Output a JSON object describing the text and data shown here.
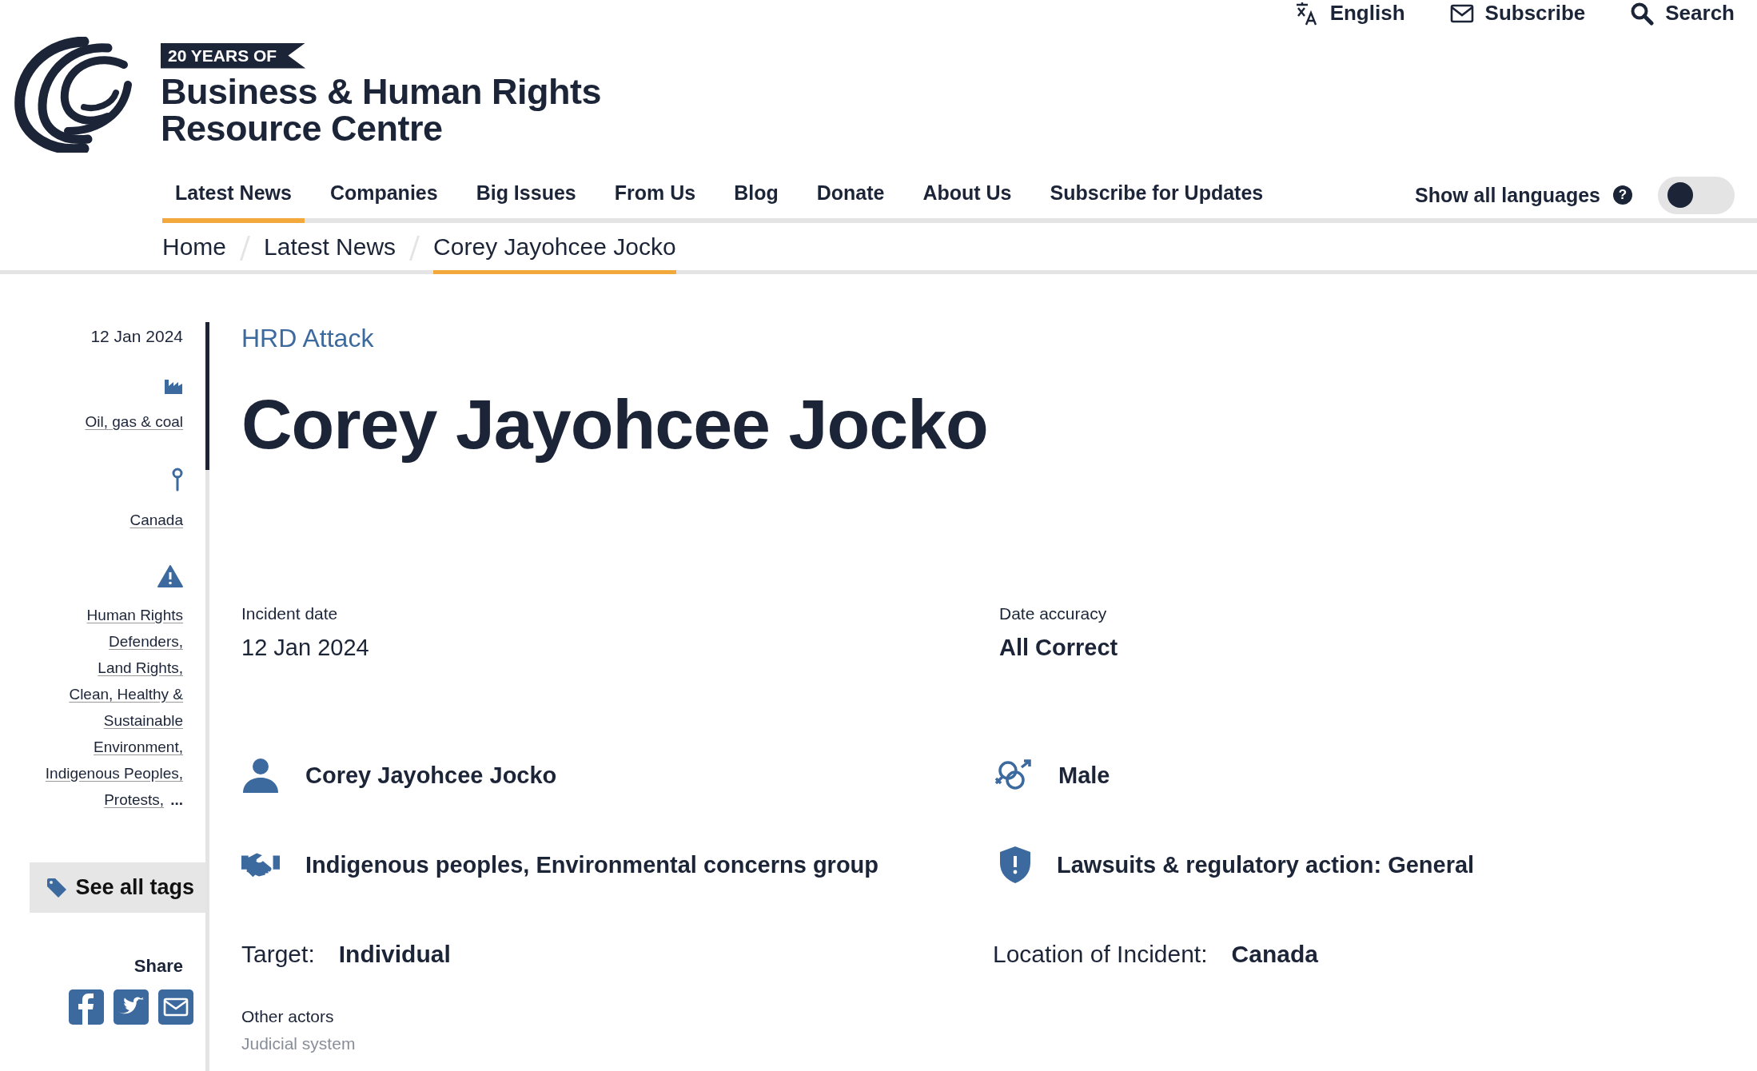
{
  "utility_links": [
    {
      "kind": "translate",
      "label": "English"
    },
    {
      "kind": "mail",
      "label": "Subscribe"
    },
    {
      "kind": "search",
      "label": "Search"
    }
  ],
  "brand": {
    "badge": "20 YEARS OF",
    "name_line_1": "Business & Human Rights",
    "name_line_2": "Resource Centre"
  },
  "nav": [
    {
      "label": "Latest News",
      "selected": true
    },
    {
      "label": "Companies",
      "selected": false
    },
    {
      "label": "Big Issues",
      "selected": false
    },
    {
      "label": "From Us",
      "selected": false
    },
    {
      "label": "Blog",
      "selected": false
    },
    {
      "label": "Donate",
      "selected": false
    },
    {
      "label": "About Us",
      "selected": false
    },
    {
      "label": "Subscribe for Updates",
      "selected": false
    }
  ],
  "language_toggle": {
    "label": "Show all languages",
    "help": "?",
    "on": false
  },
  "breadcrumb": [
    {
      "label": "Home",
      "selected": false
    },
    {
      "label": "Latest News",
      "selected": false
    },
    {
      "label": "Corey Jayohcee Jocko",
      "selected": true
    }
  ],
  "sidebar": {
    "date": "12 Jan 2024",
    "tag_groups": [
      {
        "kind": "industry",
        "links": [
          "Oil, gas & coal"
        ]
      },
      {
        "kind": "location",
        "links": [
          "Canada"
        ]
      },
      {
        "kind": "issue",
        "links": [
          "Human Rights Defenders,",
          "Land Rights,",
          "Clean, Healthy & Sustainable Environment,",
          "Indigenous Peoples,",
          "Protests,"
        ],
        "more": "..."
      }
    ],
    "see_all_tags": "See all tags",
    "share_label": "Share",
    "share_buttons": [
      {
        "kind": "facebook"
      },
      {
        "kind": "twitter"
      },
      {
        "kind": "email"
      }
    ]
  },
  "article": {
    "category": "HRD Attack",
    "title": "Corey Jayohcee Jocko",
    "incident_date": {
      "label": "Incident date",
      "value": "12 Jan 2024"
    },
    "date_accuracy": {
      "label": "Date accuracy",
      "value": "All Correct"
    },
    "facts": [
      {
        "kind": "person",
        "text": "Corey Jayohcee Jocko"
      },
      {
        "kind": "gender",
        "text": "Male"
      },
      {
        "kind": "group",
        "text": "Indigenous peoples, Environmental concerns group"
      },
      {
        "kind": "response",
        "text": "Lawsuits & regulatory action: General"
      }
    ],
    "target": {
      "label": "Target:",
      "value": "Individual"
    },
    "location": {
      "label": "Location of Incident:",
      "value": "Canada"
    },
    "other_actors": {
      "label": "Other actors",
      "value": "Judicial system"
    }
  }
}
